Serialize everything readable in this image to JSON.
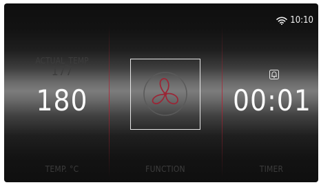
{
  "status": {
    "wifi_icon": "wifi-icon",
    "time": "10:10"
  },
  "temperature": {
    "actual_label": "ACTUAL_TEMP",
    "actual_value": "177",
    "set_value": "180",
    "panel_label": "TEMP. °C"
  },
  "function": {
    "icon": "fan-icon",
    "panel_label": "FUNCTION"
  },
  "timer": {
    "alarm_icon": "bell-icon",
    "value": "00:01",
    "panel_label": "TIMER"
  },
  "colors": {
    "divider": "#b81e32",
    "text_primary": "#fafafa",
    "text_dim": "#3c3c3c"
  }
}
